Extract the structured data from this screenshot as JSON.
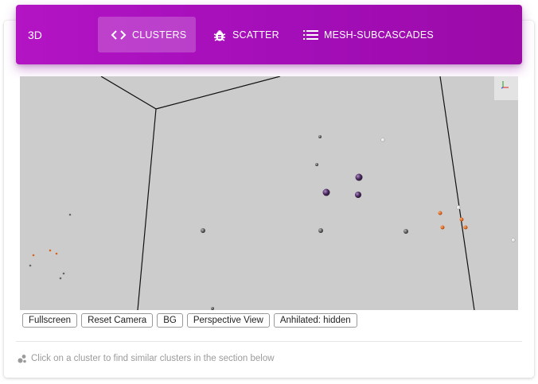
{
  "header": {
    "brand": "3D",
    "tabs": [
      {
        "label": "CLUSTERS",
        "icon": "code-icon",
        "active": true
      },
      {
        "label": "SCATTER",
        "icon": "bug-icon",
        "active": false
      },
      {
        "label": "MESH-SUBCASCADES",
        "icon": "list-icon",
        "active": false
      }
    ],
    "accent": "#a30eb8"
  },
  "viewer": {
    "background": "#cccccc",
    "colors": {
      "gray": "#555555",
      "purple": "#4a2a5e",
      "orange": "#d9651f",
      "white": "#f2f2f2"
    }
  },
  "buttons": {
    "fullscreen": "Fullscreen",
    "reset_camera": "Reset Camera",
    "bg": "BG",
    "perspective": "Perspective View",
    "anhilated": "Anhilated: hidden"
  },
  "hint": {
    "text": "Click on a cluster to find similar clusters in the section below",
    "icon": "bubble-chart-icon"
  }
}
